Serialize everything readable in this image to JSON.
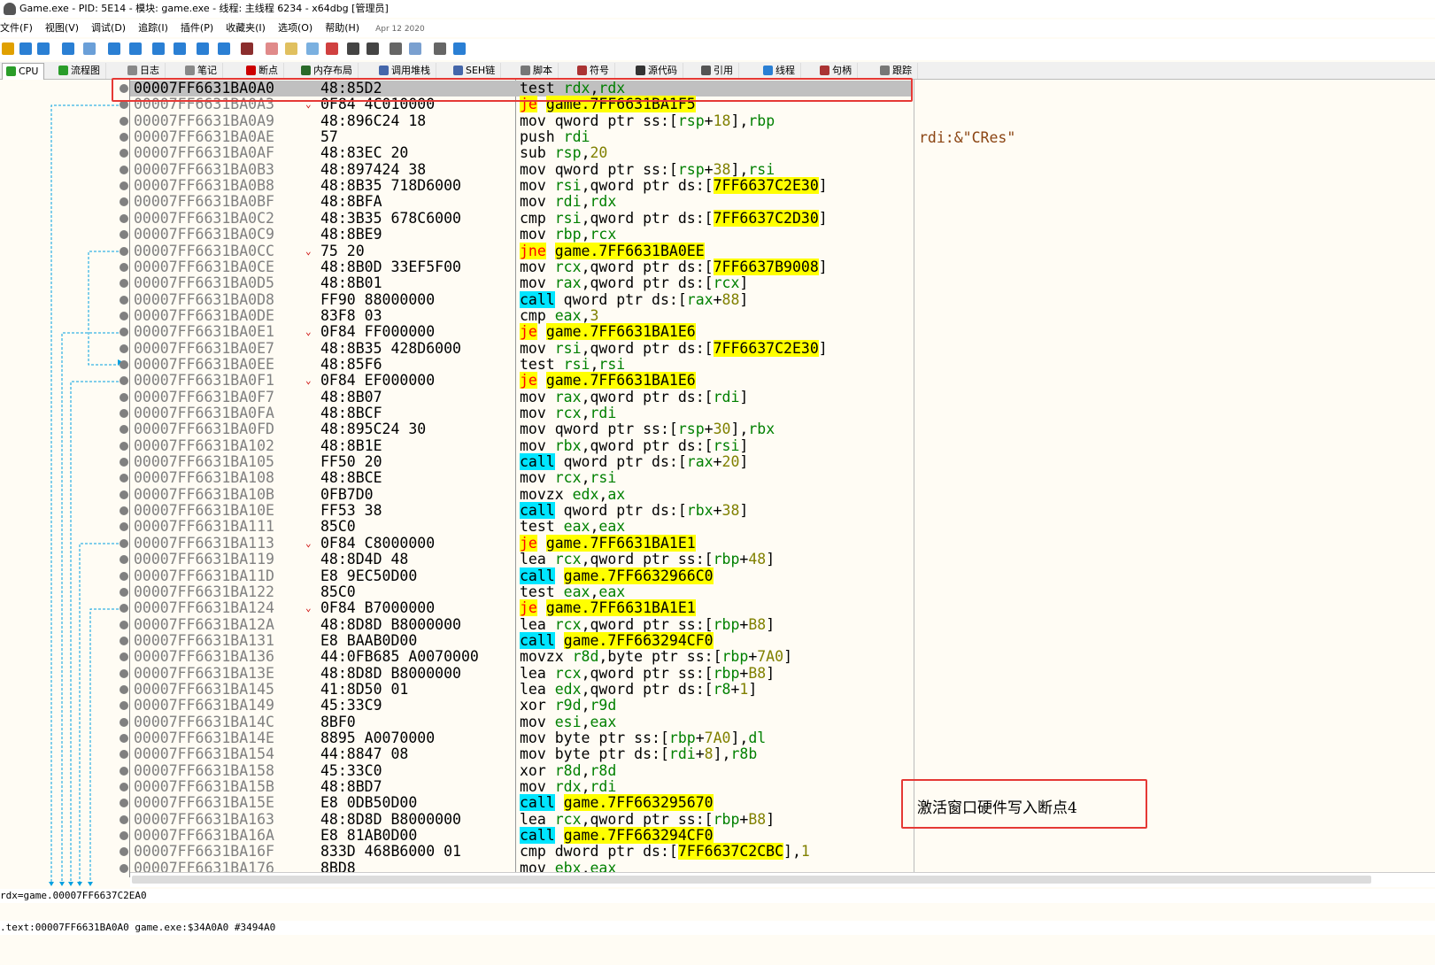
{
  "window": {
    "title": "Game.exe - PID: 5E14 - 模块: game.exe - 线程: 主线程 6234 - x64dbg [管理员]"
  },
  "menu": [
    "文件(F)",
    "视图(V)",
    "调试(D)",
    "追踪(I)",
    "插件(P)",
    "收藏夹(I)",
    "选项(O)",
    "帮助(H)"
  ],
  "menu_date": "Apr 12 2020",
  "tabs": [
    "CPU",
    "流程图",
    "日志",
    "笔记",
    "断点",
    "内存布局",
    "调用堆栈",
    "SEH链",
    "脚本",
    "符号",
    "源代码",
    "引用",
    "线程",
    "句柄",
    "跟踪"
  ],
  "rows": [
    {
      "addr": "00007FF6631BA0A0",
      "bytes": "48:85D2",
      "dis": "test rdx,rdx"
    },
    {
      "addr": "00007FF6631BA0A3",
      "bytes": "0F84 4C010000",
      "dis": "je game.7FF6631BA1F5"
    },
    {
      "addr": "00007FF6631BA0A9",
      "bytes": "48:896C24 18",
      "dis": "mov qword ptr ss:[rsp+18],rbp"
    },
    {
      "addr": "00007FF6631BA0AE",
      "bytes": "57",
      "dis": "push rdi"
    },
    {
      "addr": "00007FF6631BA0AF",
      "bytes": "48:83EC 20",
      "dis": "sub rsp,20"
    },
    {
      "addr": "00007FF6631BA0B3",
      "bytes": "48:897424 38",
      "dis": "mov qword ptr ss:[rsp+38],rsi"
    },
    {
      "addr": "00007FF6631BA0B8",
      "bytes": "48:8B35 718D6000",
      "dis": "mov rsi,qword ptr ds:[7FF6637C2E30]"
    },
    {
      "addr": "00007FF6631BA0BF",
      "bytes": "48:8BFA",
      "dis": "mov rdi,rdx"
    },
    {
      "addr": "00007FF6631BA0C2",
      "bytes": "48:3B35 678C6000",
      "dis": "cmp rsi,qword ptr ds:[7FF6637C2D30]"
    },
    {
      "addr": "00007FF6631BA0C9",
      "bytes": "48:8BE9",
      "dis": "mov rbp,rcx"
    },
    {
      "addr": "00007FF6631BA0CC",
      "bytes": "75 20",
      "dis": "jne game.7FF6631BA0EE"
    },
    {
      "addr": "00007FF6631BA0CE",
      "bytes": "48:8B0D 33EF5F00",
      "dis": "mov rcx,qword ptr ds:[7FF6637B9008]"
    },
    {
      "addr": "00007FF6631BA0D5",
      "bytes": "48:8B01",
      "dis": "mov rax,qword ptr ds:[rcx]"
    },
    {
      "addr": "00007FF6631BA0D8",
      "bytes": "FF90 88000000",
      "dis": "call qword ptr ds:[rax+88]"
    },
    {
      "addr": "00007FF6631BA0DE",
      "bytes": "83F8 03",
      "dis": "cmp eax,3"
    },
    {
      "addr": "00007FF6631BA0E1",
      "bytes": "0F84 FF000000",
      "dis": "je game.7FF6631BA1E6"
    },
    {
      "addr": "00007FF6631BA0E7",
      "bytes": "48:8B35 428D6000",
      "dis": "mov rsi,qword ptr ds:[7FF6637C2E30]"
    },
    {
      "addr": "00007FF6631BA0EE",
      "bytes": "48:85F6",
      "dis": "test rsi,rsi"
    },
    {
      "addr": "00007FF6631BA0F1",
      "bytes": "0F84 EF000000",
      "dis": "je game.7FF6631BA1E6"
    },
    {
      "addr": "00007FF6631BA0F7",
      "bytes": "48:8B07",
      "dis": "mov rax,qword ptr ds:[rdi]"
    },
    {
      "addr": "00007FF6631BA0FA",
      "bytes": "48:8BCF",
      "dis": "mov rcx,rdi"
    },
    {
      "addr": "00007FF6631BA0FD",
      "bytes": "48:895C24 30",
      "dis": "mov qword ptr ss:[rsp+30],rbx"
    },
    {
      "addr": "00007FF6631BA102",
      "bytes": "48:8B1E",
      "dis": "mov rbx,qword ptr ds:[rsi]"
    },
    {
      "addr": "00007FF6631BA105",
      "bytes": "FF50 20",
      "dis": "call qword ptr ds:[rax+20]"
    },
    {
      "addr": "00007FF6631BA108",
      "bytes": "48:8BCE",
      "dis": "mov rcx,rsi"
    },
    {
      "addr": "00007FF6631BA10B",
      "bytes": "0FB7D0",
      "dis": "movzx edx,ax"
    },
    {
      "addr": "00007FF6631BA10E",
      "bytes": "FF53 38",
      "dis": "call qword ptr ds:[rbx+38]"
    },
    {
      "addr": "00007FF6631BA111",
      "bytes": "85C0",
      "dis": "test eax,eax"
    },
    {
      "addr": "00007FF6631BA113",
      "bytes": "0F84 C8000000",
      "dis": "je game.7FF6631BA1E1"
    },
    {
      "addr": "00007FF6631BA119",
      "bytes": "48:8D4D 48",
      "dis": "lea rcx,qword ptr ss:[rbp+48]"
    },
    {
      "addr": "00007FF6631BA11D",
      "bytes": "E8 9EC50D00",
      "dis": "call game.7FF6632966C0"
    },
    {
      "addr": "00007FF6631BA122",
      "bytes": "85C0",
      "dis": "test eax,eax"
    },
    {
      "addr": "00007FF6631BA124",
      "bytes": "0F84 B7000000",
      "dis": "je game.7FF6631BA1E1"
    },
    {
      "addr": "00007FF6631BA12A",
      "bytes": "48:8D8D B8000000",
      "dis": "lea rcx,qword ptr ss:[rbp+B8]"
    },
    {
      "addr": "00007FF6631BA131",
      "bytes": "E8 BAAB0D00",
      "dis": "call game.7FF663294CF0"
    },
    {
      "addr": "00007FF6631BA136",
      "bytes": "44:0FB685 A0070000",
      "dis": "movzx r8d,byte ptr ss:[rbp+7A0]"
    },
    {
      "addr": "00007FF6631BA13E",
      "bytes": "48:8D8D B8000000",
      "dis": "lea rcx,qword ptr ss:[rbp+B8]"
    },
    {
      "addr": "00007FF6631BA145",
      "bytes": "41:8D50 01",
      "dis": "lea edx,qword ptr ds:[r8+1]"
    },
    {
      "addr": "00007FF6631BA149",
      "bytes": "45:33C9",
      "dis": "xor r9d,r9d"
    },
    {
      "addr": "00007FF6631BA14C",
      "bytes": "8BF0",
      "dis": "mov esi,eax"
    },
    {
      "addr": "00007FF6631BA14E",
      "bytes": "8895 A0070000",
      "dis": "mov byte ptr ss:[rbp+7A0],dl"
    },
    {
      "addr": "00007FF6631BA154",
      "bytes": "44:8847 08",
      "dis": "mov byte ptr ds:[rdi+8],r8b"
    },
    {
      "addr": "00007FF6631BA158",
      "bytes": "45:33C0",
      "dis": "xor r8d,r8d"
    },
    {
      "addr": "00007FF6631BA15B",
      "bytes": "48:8BD7",
      "dis": "mov rdx,rdi"
    },
    {
      "addr": "00007FF6631BA15E",
      "bytes": "E8 0DB50D00",
      "dis": "call game.7FF663295670"
    },
    {
      "addr": "00007FF6631BA163",
      "bytes": "48:8D8D B8000000",
      "dis": "lea rcx,qword ptr ss:[rbp+B8]"
    },
    {
      "addr": "00007FF6631BA16A",
      "bytes": "E8 81AB0D00",
      "dis": "call game.7FF663294CF0"
    },
    {
      "addr": "00007FF6631BA16F",
      "bytes": "833D 468B6000 01",
      "dis": "cmp dword ptr ds:[7FF6637C2CBC],1"
    },
    {
      "addr": "00007FF6631BA176",
      "bytes": "8BD8",
      "dis": "mov ebx,eax"
    }
  ],
  "comment": "rdi:&\"CRes\"",
  "note": "激活窗口硬件写入断点4",
  "status": {
    "line1": "rdx=game.00007FF6637C2EA0",
    "line2": ".text:00007FF6631BA0A0 game.exe:$34A0A0 #3494A0"
  }
}
